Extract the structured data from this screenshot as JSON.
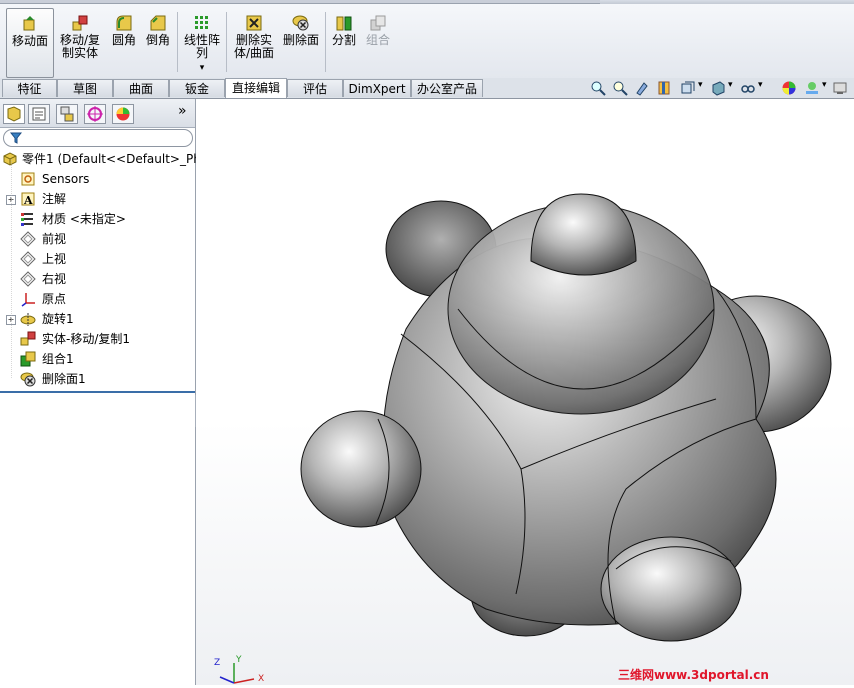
{
  "toolbar": {
    "buttons": [
      {
        "label_line1": "移动面",
        "label_line2": ""
      },
      {
        "label_line1": "移动/复",
        "label_line2": "制实体"
      },
      {
        "label_line1": "圆角",
        "label_line2": ""
      },
      {
        "label_line1": "倒角",
        "label_line2": ""
      },
      {
        "label_line1": "线性阵",
        "label_line2": "列"
      },
      {
        "label_line1": "删除实",
        "label_line2": "体/曲面"
      },
      {
        "label_line1": "删除面",
        "label_line2": ""
      },
      {
        "label_line1": "分割",
        "label_line2": ""
      },
      {
        "label_line1": "组合",
        "label_line2": ""
      }
    ],
    "dropdown_arrow": "▾"
  },
  "tabs": [
    "特征",
    "草图",
    "曲面",
    "钣金",
    "直接编辑",
    "评估",
    "DimXpert",
    "办公室产品"
  ],
  "active_tab": "直接编辑",
  "panel": {
    "expand_glyph": "»",
    "filter_icon": "funnel-icon",
    "tree": {
      "root": "零件1  (Default<<Default>_Ph",
      "items": [
        {
          "label": "Sensors",
          "icon": "sensors-icon",
          "expandable": false
        },
        {
          "label": "注解",
          "icon": "annotation-icon",
          "expandable": true
        },
        {
          "label": "材质 <未指定>",
          "icon": "material-icon",
          "expandable": false
        },
        {
          "label": "前视",
          "icon": "plane-icon",
          "expandable": false
        },
        {
          "label": "上视",
          "icon": "plane-icon",
          "expandable": false
        },
        {
          "label": "右视",
          "icon": "plane-icon",
          "expandable": false
        },
        {
          "label": "原点",
          "icon": "origin-icon",
          "expandable": false
        },
        {
          "label": "旋转1",
          "icon": "revolve-icon",
          "expandable": true
        },
        {
          "label": "实体-移动/复制1",
          "icon": "move-copy-icon",
          "expandable": false
        },
        {
          "label": "组合1",
          "icon": "combine-icon",
          "expandable": false
        },
        {
          "label": "删除面1",
          "icon": "delete-face-icon",
          "expandable": false
        }
      ]
    }
  },
  "watermark": "三维网www.3dportal.cn",
  "triad": {
    "x": "X",
    "y": "Y",
    "z": "Z"
  },
  "colors": {
    "accent": "#3a6ea8",
    "watermark": "#e0162b",
    "model": "#8c8c8c"
  }
}
